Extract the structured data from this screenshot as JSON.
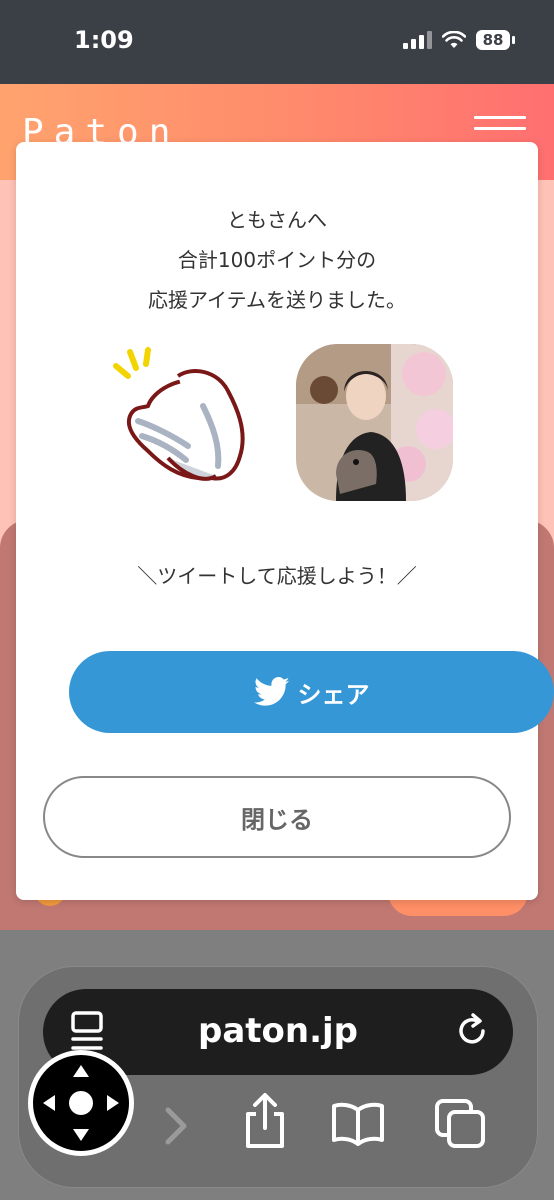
{
  "status_bar": {
    "time": "1:09",
    "battery": "88"
  },
  "site": {
    "logo": "Paton"
  },
  "modal": {
    "message_lines": [
      "ともさんへ",
      "合計100ポイント分の",
      "応援アイテムを送りました。"
    ],
    "cheer_text": "＼ツイートして応援しよう！／",
    "share_label": "シェア",
    "close_label": "閉じる"
  },
  "browser": {
    "url": "paton.jp"
  },
  "colors": {
    "share": "#3697d6",
    "header_start": "#ffa36e",
    "header_end": "#ff6f70"
  }
}
